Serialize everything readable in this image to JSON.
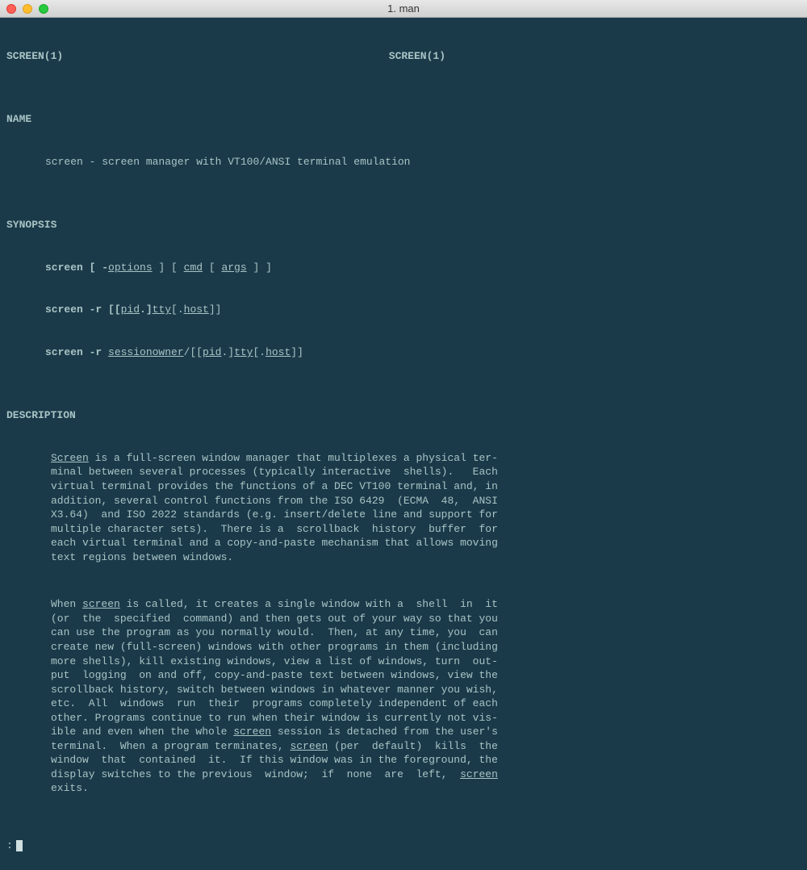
{
  "window": {
    "title": "1. man"
  },
  "man": {
    "header_left": "SCREEN(1)",
    "header_right": "SCREEN(1)",
    "sections": {
      "name": "NAME",
      "synopsis": "SYNOPSIS",
      "description": "DESCRIPTION"
    },
    "name_line_pre": "screen - screen manager with VT100/ANSI terminal emulation",
    "syn_prefix": "screen",
    "syn_l1": {
      "a": "screen [ -",
      "opts": "options",
      "b": " ] [ ",
      "cmd": "cmd",
      "c": " [ ",
      "args": "args",
      "d": " ] ]"
    },
    "syn_l2": {
      "a": "screen -r [[",
      "pid": "pid",
      "b": ".]",
      "tty": "tty",
      "c": "[.",
      "host": "host",
      "d": "]]"
    },
    "syn_l3": {
      "a": "screen -r ",
      "so": "sessionowner",
      "b": "/[[",
      "pid": "pid",
      "c": ".]",
      "tty": "tty",
      "d": "[.",
      "host": "host",
      "e": "]]"
    },
    "desc_p1": {
      "pre": "Screen",
      "rest": " is a full-screen window manager that multiplexes a physical ter-\nminal between several processes (typically interactive  shells).   Each\nvirtual terminal provides the functions of a DEC VT100 terminal and, in\naddition, several control functions from the ISO 6429  (ECMA  48,  ANSI\nX3.64)  and ISO 2022 standards (e.g. insert/delete line and support for\nmultiple character sets).  There is a  scrollback  history  buffer  for\neach virtual terminal and a copy-and-paste mechanism that allows moving\ntext regions between windows."
    },
    "desc_p2": {
      "a": "When ",
      "scr1": "screen",
      "b": " is called, it creates a single window with a  shell  in  it\n(or  the  specified  command) and then gets out of your way so that you\ncan use the program as you normally would.  Then, at any time, you  can\ncreate new (full-screen) windows with other programs in them (including\nmore shells), kill existing windows, view a list of windows, turn  out-\nput  logging  on and off, copy-and-paste text between windows, view the\nscrollback history, switch between windows in whatever manner you wish,\netc.  All  windows  run  their  programs completely independent of each\nother. Programs continue to run when their window is currently not vis-\nible and even when the whole ",
      "scr2": "screen",
      "c": " session is detached from the user's\nterminal.  When a program terminates, ",
      "scr3": "screen",
      "d": " (per  default)  kills  the\nwindow  that  contained  it.  If this window was in the foreground, the\ndisplay switches to the previous  window;  if  none  are  left,  ",
      "scr4": "screen",
      "e": "\nexits."
    },
    "prompt": ":"
  }
}
